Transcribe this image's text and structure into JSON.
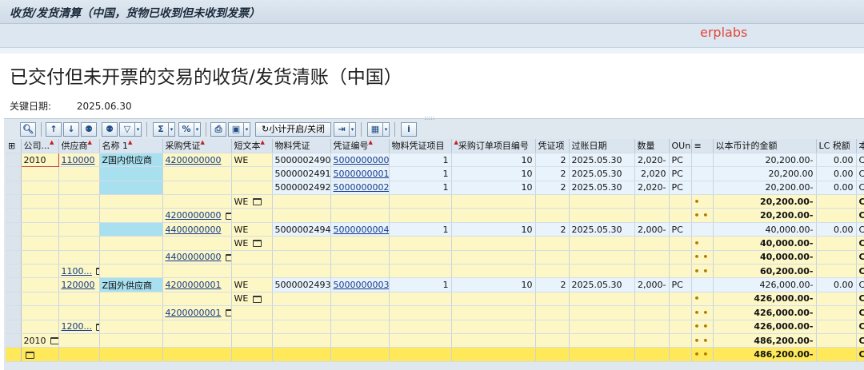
{
  "window": {
    "title": "收货/发货清算（中国，货物已收到但未收到发票）",
    "watermark": "erplabs"
  },
  "report": {
    "heading": "已交付但未开票的交易的收货/发货清账（中国）",
    "key_date_label": "关键日期:",
    "key_date_value": "2025.06.30"
  },
  "toolbar": {
    "subtotal_toggle": "小计开启/关闭"
  },
  "columns": [
    "公司...",
    "供应商",
    "名称 1",
    "采购凭证",
    "短文本",
    "物料凭证",
    "凭证编号",
    "物料凭证项目",
    "采购订单项目编号",
    "凭证项",
    "过账日期",
    "数量",
    "OUn",
    "",
    "以本币计的金额",
    "LC 税额",
    "本币"
  ],
  "rows": {
    "r1": {
      "company": "2010",
      "vendor": "110000",
      "name": "Z国内供应商",
      "po": "4200000000",
      "short": "WE",
      "matdoc": "5000002490",
      "docno": "5000000000",
      "matitem": "1",
      "poitem": "10",
      "docitem": "2",
      "date": "2025.05.30",
      "qty": "2,020-",
      "oun": "PC",
      "amount": "20,200.00-",
      "tax": "0.00",
      "cur": "CNY"
    },
    "r2": {
      "matdoc": "5000002491",
      "docno": "5000000001",
      "matitem": "1",
      "poitem": "10",
      "docitem": "2",
      "date": "2025.05.30",
      "qty": "2,020",
      "oun": "PC",
      "amount": "20,200.00",
      "tax": "0.00",
      "cur": "CNY"
    },
    "r3": {
      "matdoc": "5000002492",
      "docno": "5000000002",
      "matitem": "1",
      "poitem": "10",
      "docitem": "2",
      "date": "2025.05.30",
      "qty": "2,020-",
      "oun": "PC",
      "amount": "20,200.00-",
      "tax": "0.00",
      "cur": "CNY"
    },
    "s4": {
      "short": "WE",
      "dots": "•",
      "amount": "20,200.00-",
      "cur": "CNY"
    },
    "s5": {
      "po": "4200000000",
      "dots": "• •",
      "amount": "20,200.00-",
      "cur": "CNY"
    },
    "r6": {
      "po": "4400000000",
      "short": "WE",
      "matdoc": "5000002494",
      "docno": "5000000004",
      "matitem": "1",
      "poitem": "10",
      "docitem": "2",
      "date": "2025.05.30",
      "qty": "2,000-",
      "oun": "PC",
      "amount": "40,000.00-",
      "tax": "0.00",
      "cur": "CNY"
    },
    "s7": {
      "short": "WE",
      "dots": "•",
      "amount": "40,000.00-",
      "cur": "CNY"
    },
    "s8": {
      "po": "4400000000",
      "dots": "• •",
      "amount": "40,000.00-",
      "cur": "CNY"
    },
    "s9": {
      "vendor": "1100...",
      "dots": "• • •",
      "amount": "60,200.00-",
      "cur": "CNY"
    },
    "r10": {
      "vendor": "120000",
      "name": "Z国外供应商",
      "po": "4200000001",
      "short": "WE",
      "matdoc": "5000002493",
      "docno": "5000000003",
      "matitem": "1",
      "poitem": "10",
      "docitem": "2",
      "date": "2025.05.30",
      "qty": "2,000-",
      "oun": "PC",
      "amount": "426,000.00-",
      "tax": "0.00",
      "cur": "CNY"
    },
    "s11": {
      "short": "WE",
      "dots": "•",
      "amount": "426,000.00-",
      "cur": "CNY"
    },
    "s12": {
      "po": "4200000001",
      "dots": "• •",
      "amount": "426,000.00-",
      "cur": "CNY"
    },
    "s13": {
      "vendor": "1200...",
      "dots": "• • •",
      "amount": "426,000.00-",
      "cur": "CNY"
    },
    "s14": {
      "company": "2010",
      "dots": "• • • •",
      "amount": "486,200.00-",
      "cur": "CNY"
    },
    "s15": {
      "dots": "• • • • •",
      "amount": "486,200.00-",
      "cur": "CNY"
    }
  }
}
